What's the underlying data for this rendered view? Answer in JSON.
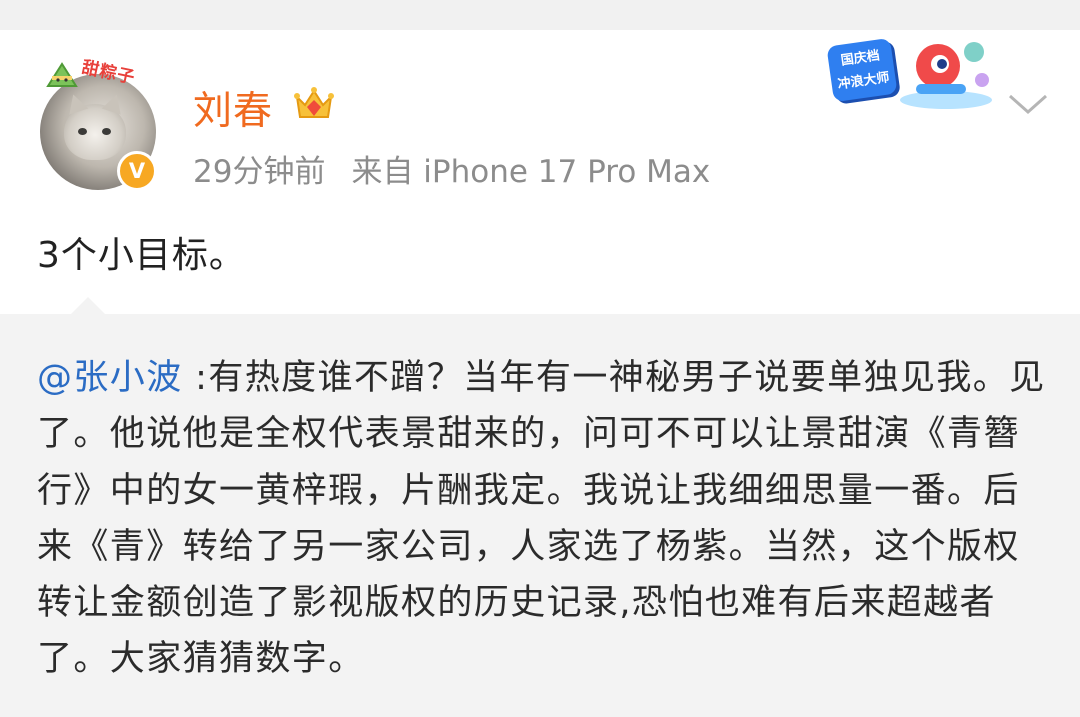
{
  "post": {
    "author": "刘春",
    "time": "29分钟前",
    "source": "来自 iPhone 17 Pro Max",
    "text": "3个小目标。",
    "avatar_pendant_text": "甜粽子",
    "verified_badge": "V",
    "promo_badge_line1": "国庆档",
    "promo_badge_line2": "冲浪大师"
  },
  "repost": {
    "mention": "@张小波",
    "text": " :有热度谁不蹭？当年有一神秘男子说要单独见我。见了。他说他是全权代表景甜来的，问可不可以让景甜演《青簪行》中的女一黄梓瑕，片酬我定。我说让我细细思量一番。后来《青》转给了另一家公司，人家选了杨紫。当然，这个版权转让金额创造了影视版权的历史记录,恐怕也难有后来超越者了。大家猜猜数字。"
  },
  "icons": {
    "vip": "crown-gem-icon",
    "more": "chevron-down-icon"
  },
  "colors": {
    "username": "#f06a1f",
    "mention": "#2b6cc4",
    "meta": "#8c8c8c",
    "repost_bg": "#f3f3f3",
    "badge": "#f7a823"
  }
}
